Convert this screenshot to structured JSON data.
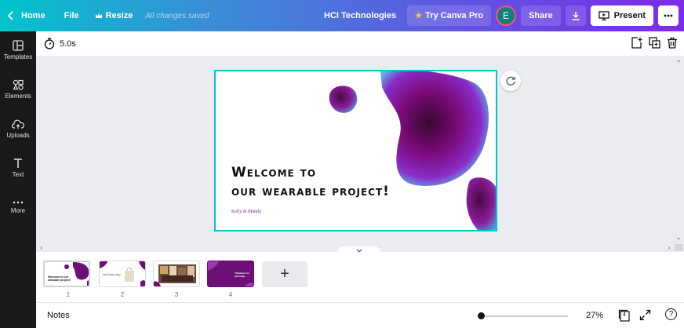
{
  "topbar": {
    "home": "Home",
    "file": "File",
    "resize": "Resize",
    "saved_status": "All changes saved",
    "team_name": "HCI Technologies",
    "try_pro": "Try Canva Pro",
    "avatar_letter": "E",
    "share": "Share",
    "present": "Present"
  },
  "sidebar": {
    "items": [
      {
        "label": "Templates",
        "icon": "templates-icon"
      },
      {
        "label": "Elements",
        "icon": "elements-icon"
      },
      {
        "label": "Uploads",
        "icon": "uploads-icon"
      },
      {
        "label": "Text",
        "icon": "text-icon"
      },
      {
        "label": "More",
        "icon": "more-icon"
      }
    ]
  },
  "canvas_header": {
    "duration": "5.0s"
  },
  "slide": {
    "title_line1": "Welcome to",
    "title_line2": "our wearable project!",
    "author": "Kelly & Mandy"
  },
  "thumbnails": {
    "pages": [
      {
        "number": "1",
        "title": "Welcome to our wearable project!"
      },
      {
        "number": "2",
        "title": "The Knitting bag!"
      },
      {
        "number": "3",
        "title": ""
      },
      {
        "number": "4",
        "title": "Thankyou for listening!"
      }
    ],
    "add_symbol": "+"
  },
  "footer": {
    "notes": "Notes",
    "zoom": "27%",
    "page_count": "4",
    "help": "?",
    "zoom_level_fraction": 0.0
  },
  "colors": {
    "accent": "#00c4cc",
    "brand_purple": "#7d2ae8",
    "sidebar_bg": "#18191b",
    "avatar_bg": "#10807d"
  }
}
